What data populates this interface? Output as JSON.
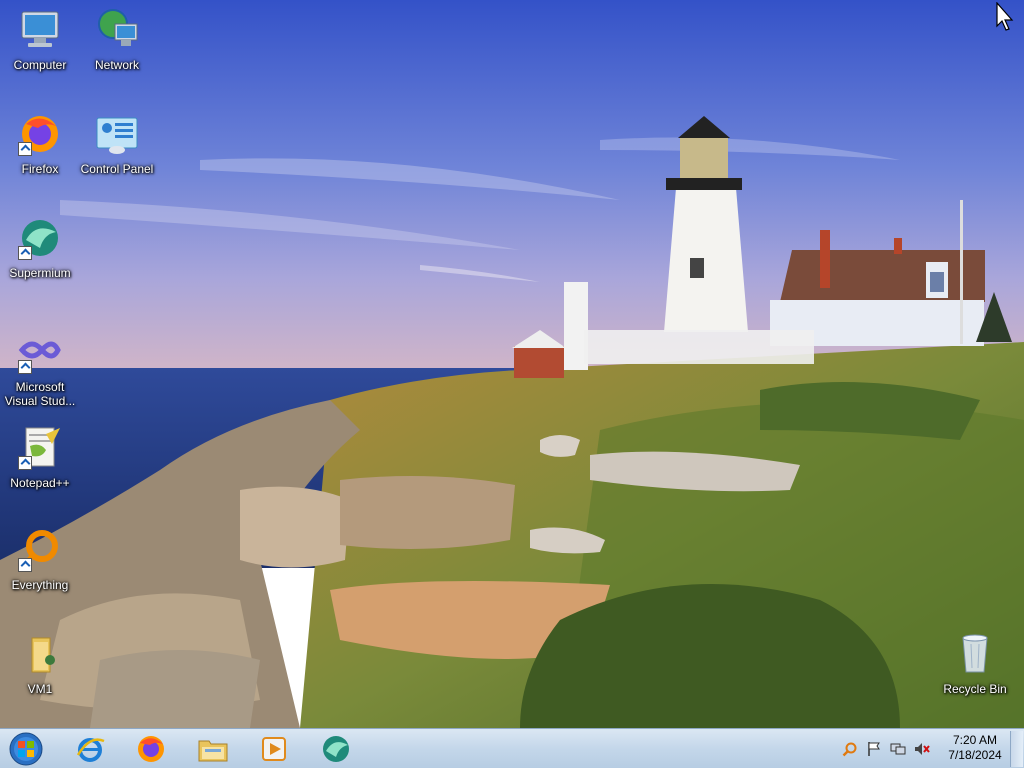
{
  "desktop": {
    "icons": [
      {
        "name": "Computer"
      },
      {
        "name": "Network"
      },
      {
        "name": "Firefox"
      },
      {
        "name": "Control Panel"
      },
      {
        "name": "Supermium"
      },
      {
        "name": "Microsoft Visual Stud..."
      },
      {
        "name": "Notepad++"
      },
      {
        "name": "Everything"
      },
      {
        "name": "VM1"
      },
      {
        "name": "Recycle Bin"
      }
    ]
  },
  "taskbar": {
    "pinned": [
      "internet-explorer-icon",
      "firefox-icon",
      "file-explorer-icon",
      "media-player-icon",
      "supermium-icon"
    ],
    "clock": {
      "time": "7:20 AM",
      "date": "7/18/2024"
    }
  },
  "colors": {
    "sky_top": "#3b5bd0",
    "sea": "#23418c",
    "taskbar": "#c4d7ea"
  }
}
